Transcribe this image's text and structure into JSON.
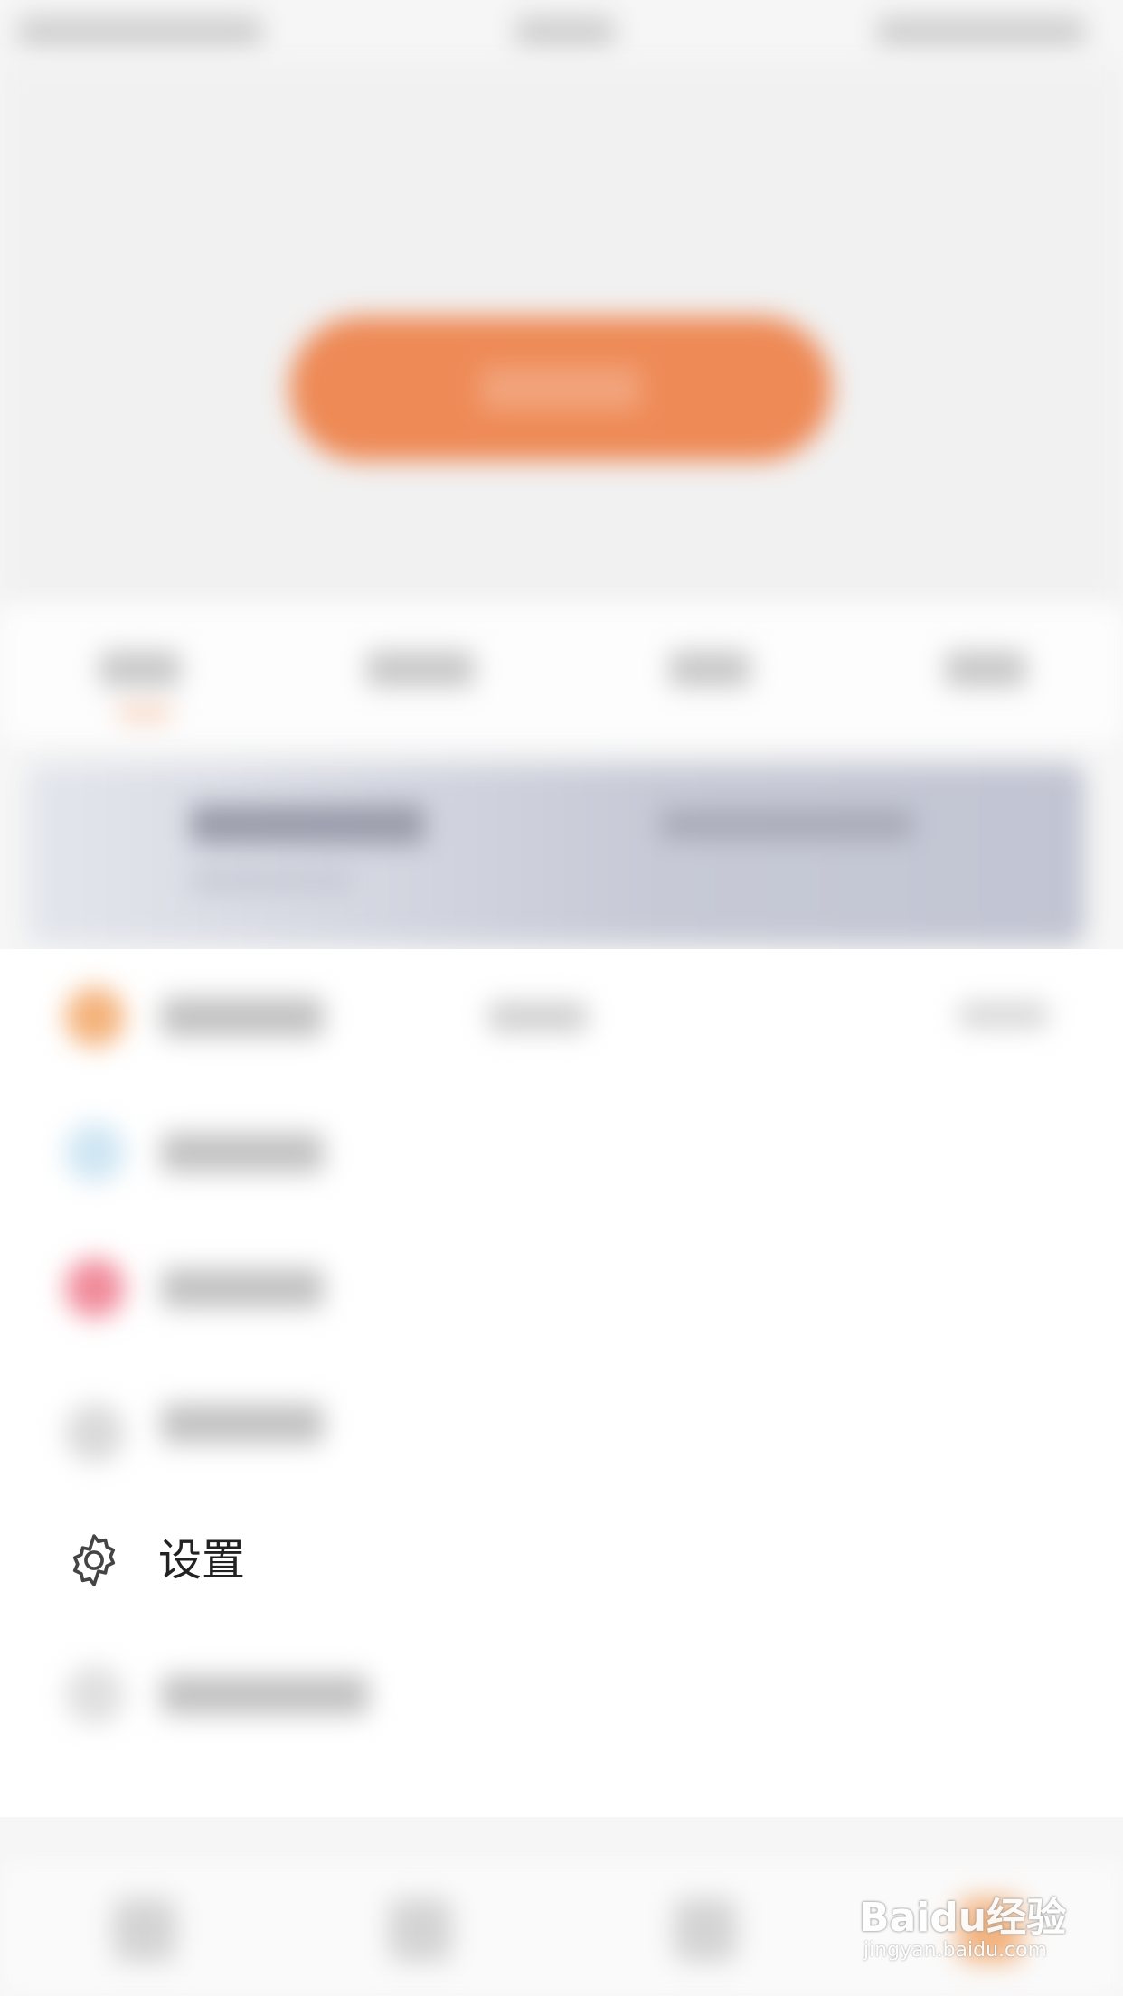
{
  "settings": {
    "label": "设置",
    "icon": "gear-icon"
  },
  "watermark": {
    "main": "Baidu经验",
    "sub": "jingyan.baidu.com"
  },
  "colors": {
    "accent": "#ee8a56",
    "banner": "#c7cad6",
    "background": "#f6f6f6"
  }
}
